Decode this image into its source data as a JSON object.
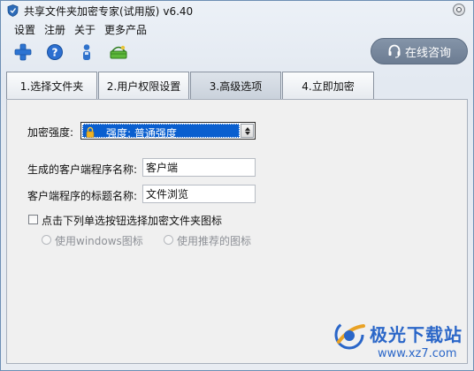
{
  "window": {
    "title": "共享文件夹加密专家(试用版)",
    "version": "v6.40"
  },
  "menu": {
    "items": [
      "设置",
      "注册",
      "关于",
      "更多产品"
    ]
  },
  "toolbar": {
    "icons": [
      "add-icon",
      "help-icon",
      "user-icon",
      "basket-icon"
    ],
    "consult_label": "在线咨询"
  },
  "tabs": [
    {
      "label": "1.选择文件夹"
    },
    {
      "label": "2.用户权限设置"
    },
    {
      "label": "3.高级选项"
    },
    {
      "label": "4.立即加密"
    }
  ],
  "active_tab": "3.高级选项",
  "advanced": {
    "strength_label": "加密强度:",
    "strength_value": "强度: 普通强度",
    "client_name_label": "生成的客户端程序名称:",
    "client_name_value": "客户端",
    "client_title_label": "客户端程序的标题名称:",
    "client_title_value": "文件浏览",
    "icon_checkbox_label": "点击下列单选按钮选择加密文件夹图标",
    "icon_checkbox_checked": false,
    "radio_windows_label": "使用windows图标",
    "radio_recommended_label": "使用推荐的图标"
  },
  "watermark": {
    "text": "极光下载站",
    "url": "www.xz7.com"
  },
  "colors": {
    "selection": "#0a5fcf",
    "consult_button": "#7787a0",
    "watermark": "#2a66c8"
  }
}
